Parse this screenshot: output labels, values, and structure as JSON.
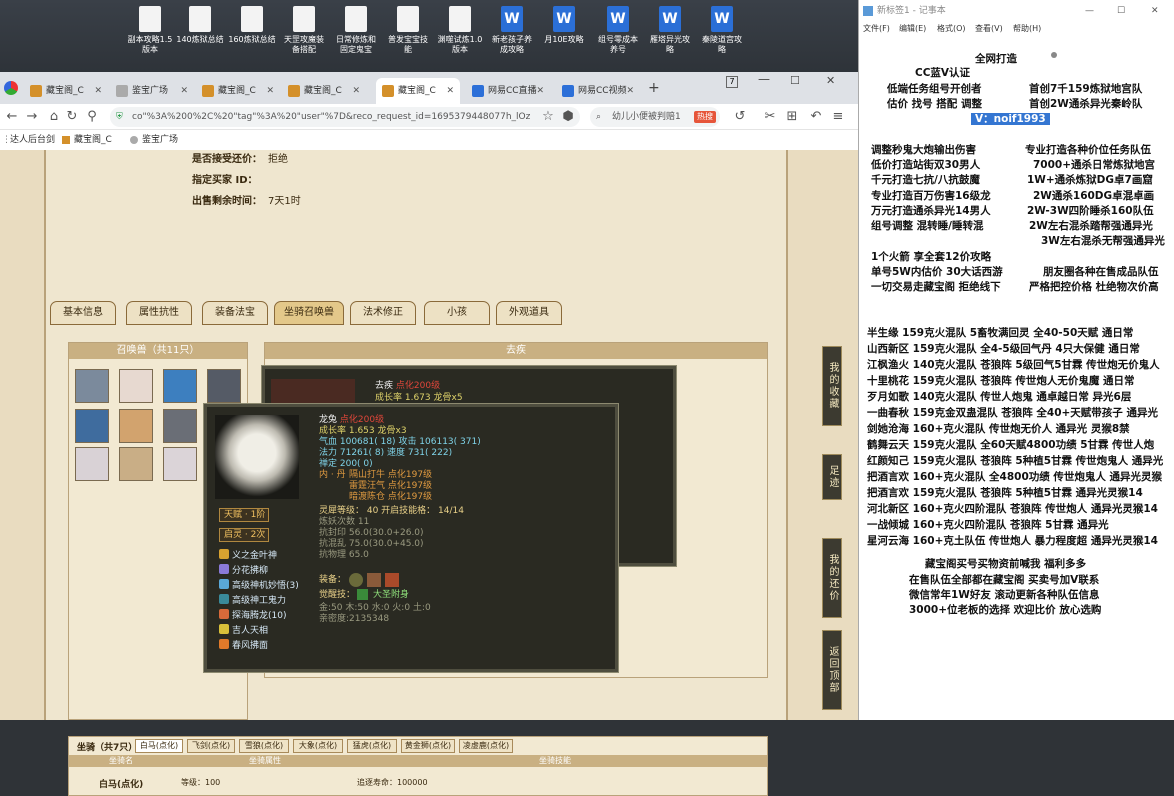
{
  "desktop": {
    "icons": [
      {
        "label1": "副本攻略1.5",
        "label2": "版本",
        "type": "txt"
      },
      {
        "label1": "140炼狱总结",
        "label2": "",
        "type": "txt"
      },
      {
        "label1": "160炼狱总结",
        "label2": "",
        "type": "txt"
      },
      {
        "label1": "天罡攻魔装",
        "label2": "备搭配",
        "type": "txt"
      },
      {
        "label1": "日常修炼和",
        "label2": "固定鬼宝",
        "type": "txt"
      },
      {
        "label1": "普发宝宝技",
        "label2": "能",
        "type": "txt"
      },
      {
        "label1": "渊噬试炼1.0",
        "label2": "版本",
        "type": "txt"
      },
      {
        "label1": "新老孩子养",
        "label2": "成攻略",
        "type": "word"
      },
      {
        "label1": "月10E攻略",
        "label2": "",
        "type": "word"
      },
      {
        "label1": "组号零成本",
        "label2": "养号",
        "type": "word"
      },
      {
        "label1": "雁塔异光攻",
        "label2": "略",
        "type": "word"
      },
      {
        "label1": "秦陵道宫攻",
        "label2": "略",
        "type": "word"
      }
    ]
  },
  "browser": {
    "tabs": [
      "藏宝阁_C",
      "鉴宝广场",
      "藏宝阁_C",
      "藏宝阁_C",
      "藏宝阁_C",
      "网易CC直播",
      "网易CC视频"
    ],
    "url": "co\"%3A%200%2C%20\"tag\"%3A%20\"user\"%7D&reco_request_id=1695379448077h_lOz",
    "search": "幼儿小便被判赔1",
    "hot": "热搜",
    "bookmarks": [
      "达人后台剑",
      "藏宝阁_C",
      "鉴宝广场"
    ]
  },
  "page": {
    "accept_label": "是否接受还价：",
    "accept_value": "拒绝",
    "buyer_label": "指定买家 ID：",
    "buyer_value": "",
    "remain_label": "出售剩余时间：",
    "remain_value": "7天1时",
    "tabs": [
      "基本信息",
      "属性抗性",
      "装备法宝",
      "坐骑召唤兽",
      "法术修正",
      "小孩",
      "外观道具"
    ],
    "pets_header": "召唤兽（共11只）",
    "right_header": "去疾",
    "qu_ji": {
      "name": "去疾",
      "tag": "点化200级",
      "growth": "成长率 1.673",
      "bone": "龙骨x5"
    },
    "longtu": {
      "name": "龙兔",
      "tag": "点化200级",
      "growth": "成长率 1.653",
      "bone": "龙骨x3",
      "qixue": "气血 100681( 18)",
      "gongji": "攻击 106113( 371)",
      "fali": "法力 71261( 8)",
      "sudu": "速度 731( 222)",
      "chanding": "禅定 200( 0)",
      "nei_label": "内 · 丹",
      "neidan": [
        "隔山打牛 点化197级",
        "雷霆汪气 点化197级",
        "暗渡陈仓 点化197级"
      ],
      "lingxi": "灵犀等级： 40 开启技能格： 14/14",
      "lianyao": "炼妖次数 11",
      "kangfeng": "抗封印 56.0(30.0+26.0)",
      "kanghun": "抗混乱 75.0(30.0+45.0)",
      "kangwu": "抗物理 65.0",
      "zhuangbei": "装备：",
      "juexing": "觉醒技：",
      "juexing_skill": "大圣附身",
      "wuxing": "金:50 木:50 水:0 火:0 土:0",
      "jiyi": "亲密度:2135348",
      "tianfu": "天赋 · 1阶",
      "qiling": "启灵 · 2次",
      "skills": [
        "义之金叶神",
        "分花拂柳",
        "高级神机妙悟(3)",
        "高级神工鬼力",
        "探海腾龙(10)",
        "吉人天相",
        "春风拂面"
      ]
    },
    "mount": {
      "title": "坐骑（共7只）",
      "tabs": [
        "白马(点化)",
        "飞剑(点化)",
        "雪狼(点化)",
        "大象(点化)",
        "猛虎(点化)",
        "黄金狮(点化)",
        "凌虚鹿(点化)"
      ],
      "col1": "坐骑名",
      "col2": "坐骑属性",
      "col3": "坐骑技能",
      "row_name": "白马(点化)",
      "row_level": "等级：100",
      "row_life": "追逐寿命：100000"
    },
    "side_buttons": [
      "我的收藏",
      "足迹",
      "我的还价",
      "返回顶部"
    ]
  },
  "notepad": {
    "title": "新标签1 - 记事本",
    "menu": [
      "文件(F)",
      "编辑(E)",
      "格式(O)",
      "查看(V)",
      "帮助(H)"
    ],
    "header_lines": [
      "全网打造",
      "CC蓝V认证",
      "低端任务组号开创者",
      "首创7千159炼狱地宫队",
      "估价 找号 搭配 调整",
      "首创2W通杀异光秦岭队"
    ],
    "contact": "V：noif1993",
    "left_list": [
      "调整秒鬼大炮输出伤害",
      "低价打造站街双30男人",
      "千元打造七抗/八抗鼓魔",
      "专业打造百万伤害16级龙",
      "万元打造通杀异光14男人",
      "组号调整 混转睡/睡转混"
    ],
    "right_list": [
      "专业打造各种价位任务队伍",
      "7000+通杀日常炼狱地宫",
      "1W+通杀炼狱DG卓7画窟",
      "2W通杀160DG卓混卓画",
      "2W-3W四阶睡杀160队伍",
      "2W左右混杀踏帮强通异光",
      "3W左右混杀无帮强通异光"
    ],
    "promo": [
      "1个火箭 享全套12价攻略",
      "单号5W内估价 30大话西游",
      "一切交易走藏宝阁 拒绝线下"
    ],
    "promo_right": [
      "朋友圈各种在售成品队伍",
      "严格把控价格 杜绝物次价高"
    ],
    "servers": [
      "半生缘 159克火混队 5畜牧满回灵 全40-50天赋 通日常",
      "山西新区 159克火混队 全4-5级回气丹 4只大保健 通日常",
      "江枫渔火 140克火混队 苍狼阵 5级回气5甘霖 传世炮无价鬼人",
      "十里桃花 159克火混队 苍狼阵 传世炮人无价鬼魔 通日常",
      "歹月如歌 140克火混队 传世人炮鬼 通卓越日常 异光6层",
      "一曲春秋 159克金双蛊混队 苍狼阵 全40+天赋带孩子 通异光",
      "剑她沧海 160+克火混队 传世炮无价人 通异光 灵猴8禁",
      "鹤舞云天 159克火混队 全60天赋4800功绩 5甘霖 传世人炮",
      "红颜知己 159克火混队 苍狼阵 5种植5甘霖 传世炮鬼人 通异光",
      "把酒言欢 160+克火混队 全4800功绩 传世炮鬼人 通异光灵猴",
      "把酒言欢 159克火混队 苍狼阵 5种植5甘霖 通异光灵猴14",
      "河北新区 160+克火四阶混队 苍狼阵 传世炮人 通异光灵猴14",
      "一战倾城 160+克火四阶混队 苍狼阵 5甘霖 通异光",
      "星河云海 160+克土队伍 传世炮人 暴力程度超 通异光灵猴14"
    ],
    "footer": [
      "藏宝阁买号买物资前喊我 福利多多",
      "在售队伍全部都在藏宝阁 买卖号加V联系",
      "微信常年1W好友 滚动更新各种队伍信息",
      "3000+位老板的选择 欢迎比价 放心选购"
    ]
  }
}
